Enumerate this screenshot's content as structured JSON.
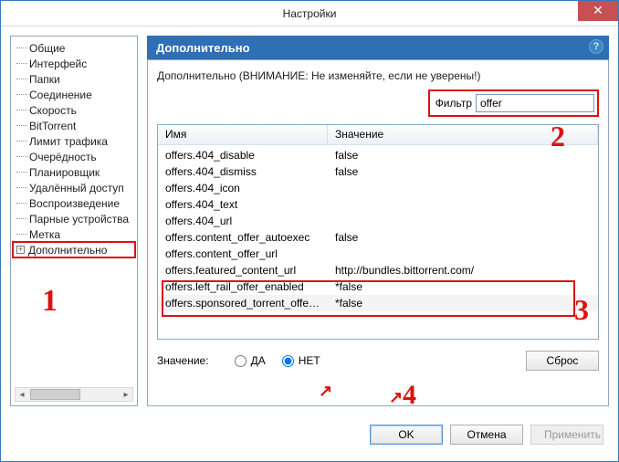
{
  "window": {
    "title": "Настройки",
    "close_icon": "✕"
  },
  "tree": {
    "items": [
      {
        "label": "Общие"
      },
      {
        "label": "Интерфейс"
      },
      {
        "label": "Папки"
      },
      {
        "label": "Соединение"
      },
      {
        "label": "Скорость"
      },
      {
        "label": "BitTorrent"
      },
      {
        "label": "Лимит трафика"
      },
      {
        "label": "Очерёдность"
      },
      {
        "label": "Планировщик"
      },
      {
        "label": "Удалённый доступ"
      },
      {
        "label": "Воспроизведение"
      },
      {
        "label": "Парные устройства"
      },
      {
        "label": "Метка"
      }
    ],
    "advanced_label": "Дополнительно",
    "plus": "+"
  },
  "content": {
    "header": "Дополнительно",
    "help": "?",
    "warning": "Дополнительно (ВНИМАНИЕ: Не изменяйте, если не уверены!)",
    "filter_label": "Фильтр",
    "filter_value": "offer",
    "columns": {
      "name": "Имя",
      "value": "Значение"
    },
    "rows": [
      {
        "name": "offers.404_disable",
        "value": "false"
      },
      {
        "name": "offers.404_dismiss",
        "value": "false"
      },
      {
        "name": "offers.404_icon",
        "value": ""
      },
      {
        "name": "offers.404_text",
        "value": ""
      },
      {
        "name": "offers.404_url",
        "value": ""
      },
      {
        "name": "offers.content_offer_autoexec",
        "value": "false"
      },
      {
        "name": "offers.content_offer_url",
        "value": ""
      },
      {
        "name": "offers.featured_content_url",
        "value": "http://bundles.bittorrent.com/"
      },
      {
        "name": "offers.left_rail_offer_enabled",
        "value": "*false"
      },
      {
        "name": "offers.sponsored_torrent_offer...",
        "value": "*false"
      }
    ],
    "value_label": "Значение:",
    "radio_yes": "ДА",
    "radio_no": "НЕТ",
    "reset": "Сброс"
  },
  "footer": {
    "ok": "OK",
    "cancel": "Отмена",
    "apply": "Применить"
  },
  "markers": {
    "m1": "1",
    "m2": "2",
    "m3": "3",
    "m4": "4"
  }
}
